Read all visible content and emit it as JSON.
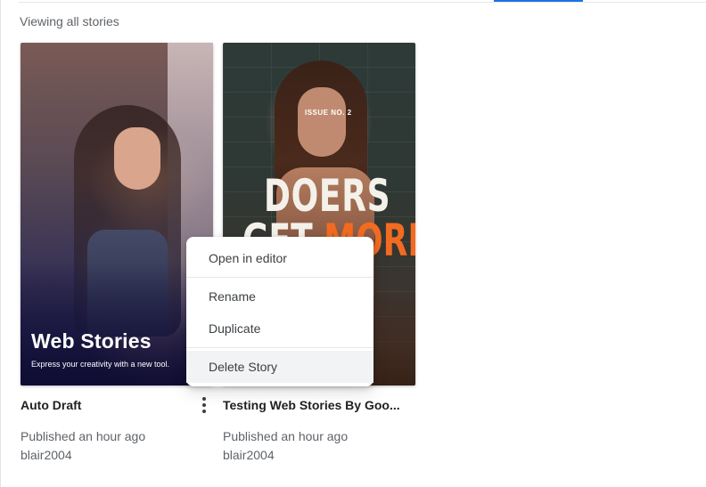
{
  "header": {
    "viewing_label": "Viewing all stories"
  },
  "stories": [
    {
      "preview": {
        "title": "Web Stories",
        "subtitle": "Express your creativity with a new tool."
      },
      "name": "Auto Draft",
      "published": "Published an hour ago",
      "author": "blair2004"
    },
    {
      "preview": {
        "issue_label": "ISSUE NO. 2",
        "headline_line1": "DOERS",
        "headline_line2_part1": "GET ",
        "headline_line2_part2": "MORE"
      },
      "name": "Testing Web Stories By Goo...",
      "published": "Published an hour ago",
      "author": "blair2004"
    }
  ],
  "context_menu": {
    "items": [
      "Open in editor",
      "Rename",
      "Duplicate",
      "Delete Story"
    ],
    "hovered_item": "Delete Story"
  },
  "colors": {
    "accent": "#1a73e8",
    "more_highlight": "#f26b21"
  },
  "icons": {
    "more_button": "vertical-ellipsis-icon"
  }
}
